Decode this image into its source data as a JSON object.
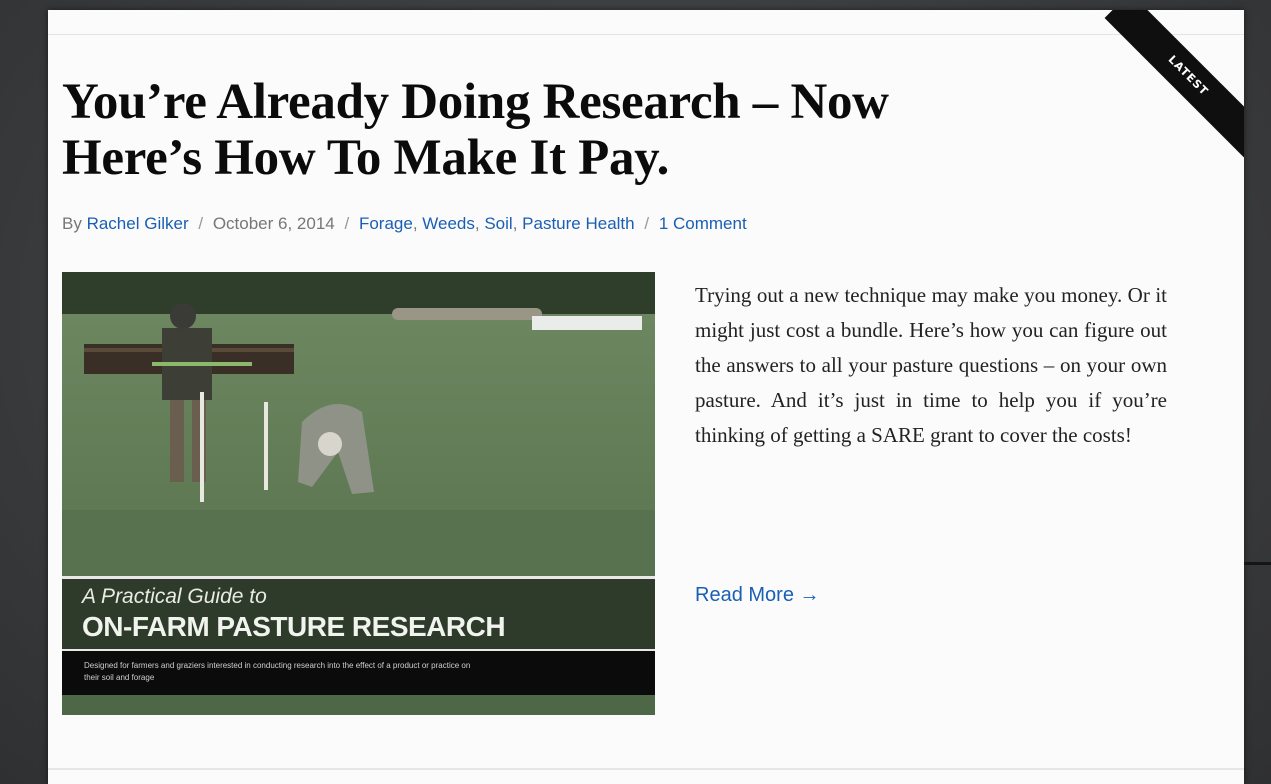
{
  "ribbon": {
    "label": "LATEST"
  },
  "post": {
    "title": "You’re Already Doing Research – Now Here’s How To Make It Pay.",
    "meta": {
      "by": "By",
      "author": "Rachel Gilker",
      "date": "October 6, 2014",
      "categories": [
        "Forage",
        "Weeds",
        "Soil",
        "Pasture Health"
      ],
      "comments": "1 Comment",
      "separator": "/"
    },
    "excerpt": "Trying out a new technique may make you money. Or it might just cost a bundle. Here’s how you can figure out the answers to all your pasture questions – on your own pasture. And it’s just in time to help you if you’re thinking of getting a SARE grant to cover the costs!",
    "read_more": "Read More →"
  },
  "thumbnail": {
    "cover_subtitle": "A Practical Guide to",
    "cover_title": "ON-FARM PASTURE RESEARCH",
    "cover_description": "Designed for farmers and graziers interested in conducting research into the effect of a product or practice on their soil and forage"
  },
  "colors": {
    "link": "#1a5fb4",
    "ribbon": "#0f0f0f",
    "title": "#0b0b0b"
  }
}
